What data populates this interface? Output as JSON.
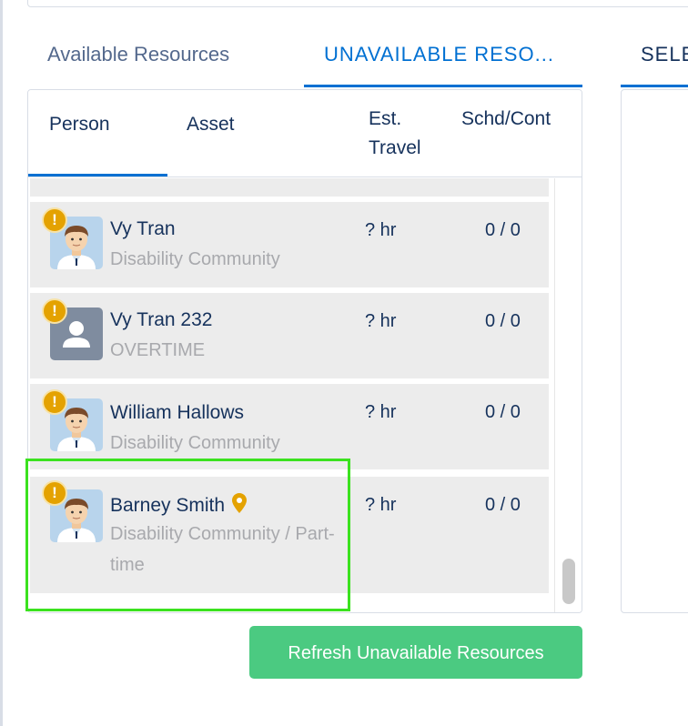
{
  "tabs": [
    {
      "label": "Available Resources",
      "active": false
    },
    {
      "label": "UNAVAILABLE RESO...",
      "active": true
    },
    {
      "label": "SELE",
      "active": false
    }
  ],
  "table": {
    "columns": {
      "person": "Person",
      "asset": "Asset",
      "travel": "Est. Travel",
      "schedule": "Schd/Cont"
    },
    "peek_text": "— — — — — — —",
    "rows": [
      {
        "name": "Vy Tran",
        "subtitle": "Disability Community",
        "travel": "? hr",
        "schedule": "0 / 0",
        "avatar": "person-avatar-icon",
        "warning": "!"
      },
      {
        "name": "Vy Tran 232",
        "subtitle": "OVERTIME",
        "travel": "? hr",
        "schedule": "0 / 0",
        "avatar": "generic-user-icon",
        "warning": "!"
      },
      {
        "name": "William Hallows",
        "subtitle": "Disability Community",
        "travel": "? hr",
        "schedule": "0 / 0",
        "avatar": "person-avatar-icon",
        "warning": "!"
      },
      {
        "name": "Barney Smith",
        "subtitle": "Disability Community / Part-time",
        "travel": "? hr",
        "schedule": "0 / 0",
        "avatar": "person-avatar-icon",
        "warning": "!",
        "location_icon": "map-pin-icon",
        "highlighted": true
      }
    ]
  },
  "refresh_button": {
    "label": "Refresh Unavailable Resources"
  },
  "colors": {
    "brand_blue": "#0070d2",
    "warning": "#e4a201",
    "button_green": "#4bca81",
    "highlight": "#3be21f"
  }
}
